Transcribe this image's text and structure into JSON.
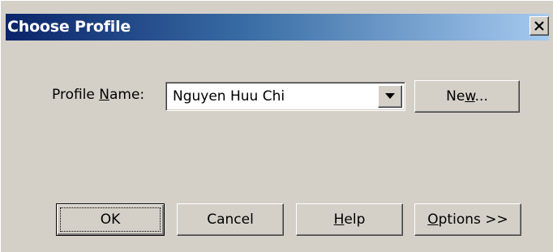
{
  "dialog": {
    "title": "Choose Profile",
    "close_glyph": "×",
    "profile_label": {
      "before": "Profile ",
      "mnemonic": "N",
      "after": "ame:"
    },
    "profile_value": "Nguyen Huu Chi",
    "buttons": {
      "new": {
        "before": "Ne",
        "mnemonic": "w",
        "after": "..."
      },
      "ok": "OK",
      "cancel": "Cancel",
      "help": {
        "before": "",
        "mnemonic": "H",
        "after": "elp"
      },
      "options": {
        "before": "",
        "mnemonic": "O",
        "after": "ptions >>"
      }
    }
  },
  "icons": {
    "close": "close-icon",
    "dropdown": "chevron-down-icon"
  },
  "colors": {
    "face": "#d4d0c8",
    "title_gradient_start": "#0a246a",
    "title_gradient_end": "#a6caf0"
  }
}
